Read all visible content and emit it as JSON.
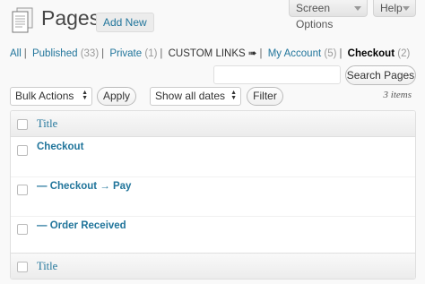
{
  "header": {
    "title": "Pages",
    "add_new_label": "Add New"
  },
  "screen_meta": {
    "screen_options_label": "Screen Options",
    "help_label": "Help"
  },
  "views": [
    {
      "label": "All",
      "count": ""
    },
    {
      "label": "Published",
      "count": "(33)"
    },
    {
      "label": "Private",
      "count": "(1)"
    },
    {
      "label": "CUSTOM LINKS ➠",
      "count": ""
    },
    {
      "label": "My Account",
      "count": "(5)"
    },
    {
      "label": "Checkout",
      "count": "(2)"
    }
  ],
  "search": {
    "placeholder": "",
    "button_label": "Search Pages"
  },
  "tablenav": {
    "bulk_actions_label": "Bulk Actions",
    "apply_label": "Apply",
    "dates_label": "Show all dates",
    "filter_label": "Filter",
    "items_count": "3 items"
  },
  "table": {
    "column_title": "Title",
    "rows": [
      {
        "title": "Checkout"
      },
      {
        "title": "— Checkout → Pay"
      },
      {
        "title": "— Order Received"
      }
    ]
  },
  "colors": {
    "link": "#21759b",
    "background": "#f9f9f9"
  }
}
